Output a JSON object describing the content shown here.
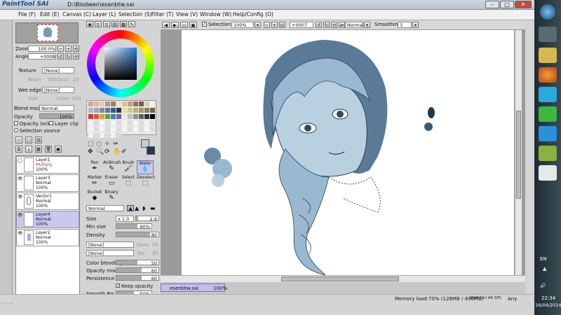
{
  "app": {
    "logo": "PaintTool SAI",
    "path": "D:\\Blodwen\\esenbtw.sai"
  },
  "menu": [
    "File (F)",
    "Edit (E)",
    "Canvas (C)",
    "Layer (L)",
    "Selection (S)",
    "Filter (T)",
    "View (V)",
    "Window (W)",
    "Help/Config (O)"
  ],
  "navigator": {
    "zoom_label": "Zoom",
    "zoom_value": "100.0%",
    "angle_label": "Angle",
    "angle_value": "+000B"
  },
  "texture": {
    "label": "Texture",
    "value": "[None]",
    "brain": "Brain",
    "brain_val": "100",
    "onal": "Onal",
    "onal_val": "20"
  },
  "wetedge": {
    "label": "Wet edge",
    "value": "[None]",
    "size": "Size",
    "color": "Color",
    "color_val": "100"
  },
  "blend": {
    "label": "Blend mode",
    "value": "Normal",
    "opacity_label": "Opacity",
    "opacity_value": "100%"
  },
  "checks": {
    "opacity_lock": "Opacity lock",
    "layer_clip": "Layer clip",
    "selection_source": "Selection source"
  },
  "layers": [
    {
      "name": "Layer1",
      "mode": "Multiply",
      "opacity": "100%",
      "selected": false
    },
    {
      "name": "Layer3",
      "mode": "Normal",
      "opacity": "100%",
      "selected": false
    },
    {
      "name": "Vector1",
      "mode": "Normal",
      "opacity": "100%",
      "selected": false
    },
    {
      "name": "Layer4",
      "mode": "Normal",
      "opacity": "100%",
      "selected": true
    },
    {
      "name": "Layer2",
      "mode": "Normal",
      "opacity": "100%",
      "selected": false
    }
  ],
  "tools": [
    {
      "label": "Pen",
      "icon": "✒"
    },
    {
      "label": "AirBrush",
      "icon": "✎"
    },
    {
      "label": "Brush",
      "icon": "🖌"
    },
    {
      "label": "Water",
      "icon": "💧"
    },
    {
      "label": "Marker",
      "icon": "✏"
    },
    {
      "label": "Eraser",
      "icon": "▭"
    },
    {
      "label": "Select",
      "icon": "⬚"
    },
    {
      "label": "Deselect",
      "icon": "⬚"
    },
    {
      "label": "Bucket",
      "icon": "◆"
    },
    {
      "label": "Binary",
      "icon": "✎"
    }
  ],
  "brush": {
    "mode": "Normal",
    "size_label": "Size",
    "size_mult": "x 1.0",
    "size_val": "2.6",
    "minsize_label": "Min size",
    "minsize_val": "60%",
    "density_label": "Density",
    "density_val": "80",
    "dropdown1": "[None]",
    "dropdown2": "[None]",
    "dens_label": "Dens",
    "dens_val": "50",
    "tex_label": "Tex.",
    "tex_val": "95",
    "colorblend_label": "Color blending",
    "colorblend_val": "50",
    "opacitymix_label": "Opacity mix",
    "opacitymix_val": "60",
    "persistence_label": "Persistence",
    "persistence_val": "60",
    "keep_opacity": "Keep opacity",
    "smooth_label": "Smooth Prs.",
    "smooth_val": "50%"
  },
  "toolbar": {
    "selection": "Selection",
    "zoom": "100%",
    "angle": "+0007",
    "mode": "Normal",
    "smoothing_label": "Smoothing",
    "smoothing_val": "3"
  },
  "doc": {
    "name": "esenbtw.sai",
    "zoom": "100%"
  },
  "status": {
    "memory": "Memory load:70% (128MB / 496MB)",
    "keys": "Shift Ctrl Alt SPC",
    "any": "Any"
  },
  "tray": {
    "lang": "EN",
    "time": "22:34",
    "date": "16/04/2014"
  },
  "colors": {
    "accent": "#4a7aa8",
    "hair_dark": "#3a5a78",
    "skin": "#b8d0e0",
    "water": "#6a9ab8"
  }
}
